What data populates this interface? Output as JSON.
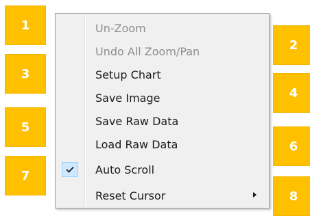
{
  "badges": [
    "1",
    "2",
    "3",
    "4",
    "5",
    "6",
    "7",
    "8"
  ],
  "colors": {
    "badge_fill": "#ffc000",
    "badge_border": "#f2b600",
    "menu_background": "#f0f0f0",
    "disabled_text": "#8d8d8d",
    "check_highlight": "#cde8ff"
  },
  "context_menu": {
    "items": [
      {
        "label": "Un-Zoom",
        "enabled": false
      },
      {
        "label": "Undo All Zoom/Pan",
        "enabled": false
      },
      {
        "label": "Setup Chart",
        "enabled": true
      },
      {
        "label": "Save Image",
        "enabled": true
      },
      {
        "label": "Save Raw Data",
        "enabled": true
      },
      {
        "label": "Load Raw Data",
        "enabled": true
      },
      {
        "label": "Auto Scroll",
        "enabled": true,
        "checked": true,
        "icon": "checkmark-icon"
      },
      {
        "label": "Reset Cursor",
        "enabled": true,
        "has_submenu": true,
        "icon": "submenu-arrow-icon"
      }
    ]
  }
}
